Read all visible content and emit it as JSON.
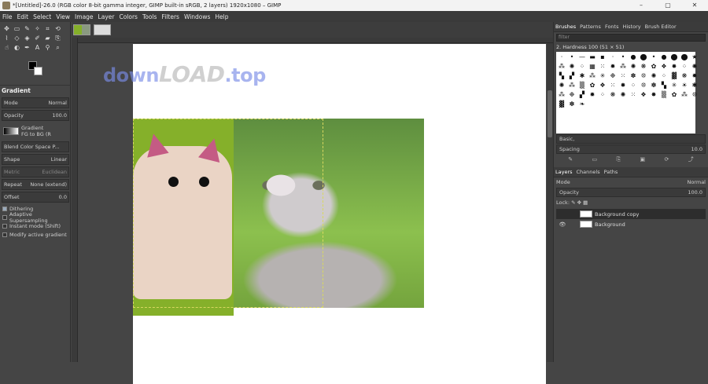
{
  "window": {
    "title": "*[Untitled]-26.0 (RGB color 8-bit gamma integer, GIMP built-in sRGB, 2 layers) 1920x1080 – GIMP",
    "minimize": "–",
    "maximize": "▢",
    "close": "✕"
  },
  "menubar": [
    "File",
    "Edit",
    "Select",
    "View",
    "Image",
    "Layer",
    "Colors",
    "Tools",
    "Filters",
    "Windows",
    "Help"
  ],
  "watermark": {
    "left": "down",
    "mid": "LOAD",
    "right": ".top"
  },
  "tool_options": {
    "title": "Gradient",
    "mode_label": "Mode",
    "mode_value": "Normal",
    "opacity_label": "Opacity",
    "opacity_value": "100.0",
    "gradient_label": "Gradient",
    "gradient_value": "FG to BG (R",
    "blend_space": "Blend Color Space P...",
    "shape_label": "Shape",
    "shape_value": "Linear",
    "metric_label": "Metric",
    "metric_value": "Euclidean",
    "repeat_label": "Repeat",
    "repeat_value": "None (extend)",
    "offset_label": "Offset",
    "offset_value": "0.0",
    "checks": [
      "Dithering",
      "Adaptive Supersampling",
      "Instant mode (Shift)",
      "Modify active gradient"
    ]
  },
  "dock": {
    "top_tabs": [
      "Brushes",
      "Patterns",
      "Fonts",
      "History",
      "Brush Editor"
    ],
    "filter_placeholder": "filter",
    "brush_name": "2. Hardness 100 (51 × 51)",
    "preset_value": "Basic,",
    "spacing_label": "Spacing",
    "spacing_value": "10.0",
    "bottom_tabs": [
      "Layers",
      "Channels",
      "Paths"
    ],
    "layer_mode_label": "Mode",
    "layer_mode_value": "Normal",
    "layer_opacity_label": "Opacity",
    "layer_opacity_value": "100.0",
    "lock_label": "Lock:",
    "layers": [
      {
        "name": "Background copy",
        "visible": false,
        "selected": true
      },
      {
        "name": "Background",
        "visible": true,
        "selected": false
      }
    ]
  }
}
